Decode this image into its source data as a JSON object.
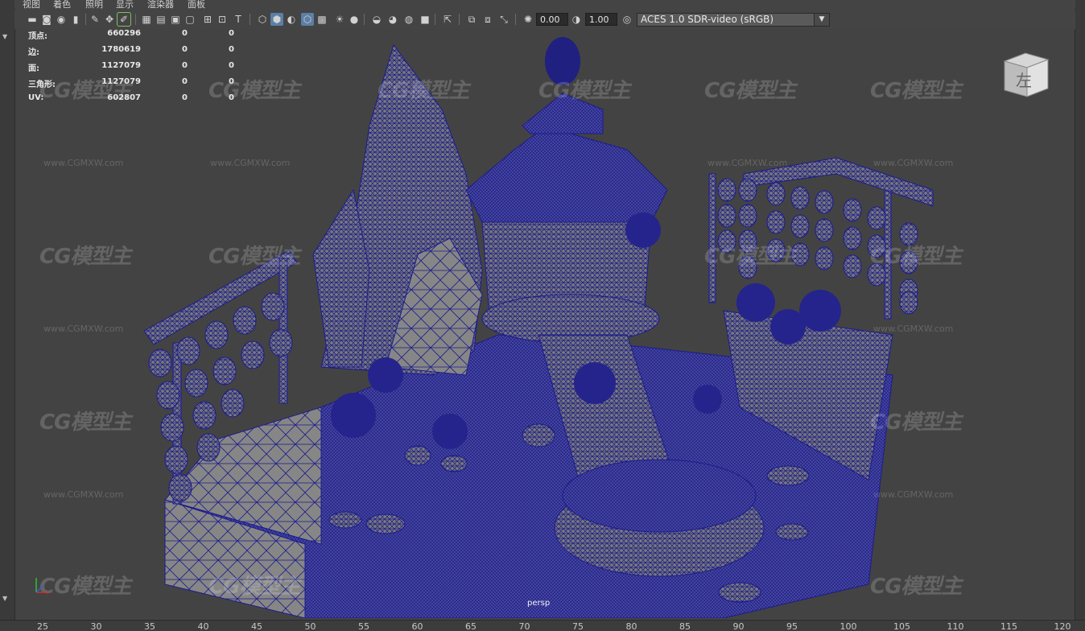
{
  "menu": [
    "视图",
    "着色",
    "照明",
    "显示",
    "渲染器",
    "面板"
  ],
  "toolbar": {
    "icons": [
      "camera-icon",
      "camera-attributes-icon",
      "bookmark-icon",
      "image-plane-icon",
      "grease-pencil-icon",
      "2d-pan-icon",
      "grid-icon",
      "film-gate-icon",
      "resolution-gate-icon",
      "gate-mask-icon",
      "field-chart-icon",
      "safe-action-icon",
      "safe-title-icon",
      "wireframe-icon",
      "smooth-shade-icon",
      "textured-icon",
      "wireframe-on-shaded-icon",
      "xray-icon",
      "lights-icon",
      "shadows-icon",
      "screen-space-ao-icon",
      "motion-blur-icon",
      "anti-alias-icon",
      "depth-of-field-icon",
      "isolate-select-icon",
      "xray-joints-icon",
      "xray-active-icon",
      "backface-culling-icon",
      "exposure-icon",
      "gamma-icon",
      "color-management-icon"
    ],
    "exposure": "0.00",
    "gamma": "1.00",
    "color_space": "ACES 1.0 SDR-video (sRGB)"
  },
  "hud": {
    "rows": [
      {
        "label": "顶点:",
        "values": [
          "660296",
          "0",
          "0"
        ]
      },
      {
        "label": "边:",
        "values": [
          "1780619",
          "0",
          "0"
        ]
      },
      {
        "label": "面:",
        "values": [
          "1127079",
          "0",
          "0"
        ]
      },
      {
        "label": "三角形:",
        "values": [
          "1127079",
          "0",
          "0"
        ]
      },
      {
        "label": "UV:",
        "values": [
          "602807",
          "0",
          "0"
        ]
      }
    ]
  },
  "view_cube": {
    "face_label": "左"
  },
  "camera": "persp",
  "watermark": {
    "brand": "CG模型主",
    "url": "www.CGMXW.com"
  },
  "time_ruler": [
    "25",
    "30",
    "35",
    "40",
    "45",
    "50",
    "55",
    "60",
    "65",
    "70",
    "75",
    "80",
    "85",
    "90",
    "95",
    "100",
    "105",
    "110",
    "115",
    "120"
  ],
  "colors": {
    "wire": "#1c1c8c",
    "shaded": "#7b7b7b",
    "background": "#444444"
  }
}
